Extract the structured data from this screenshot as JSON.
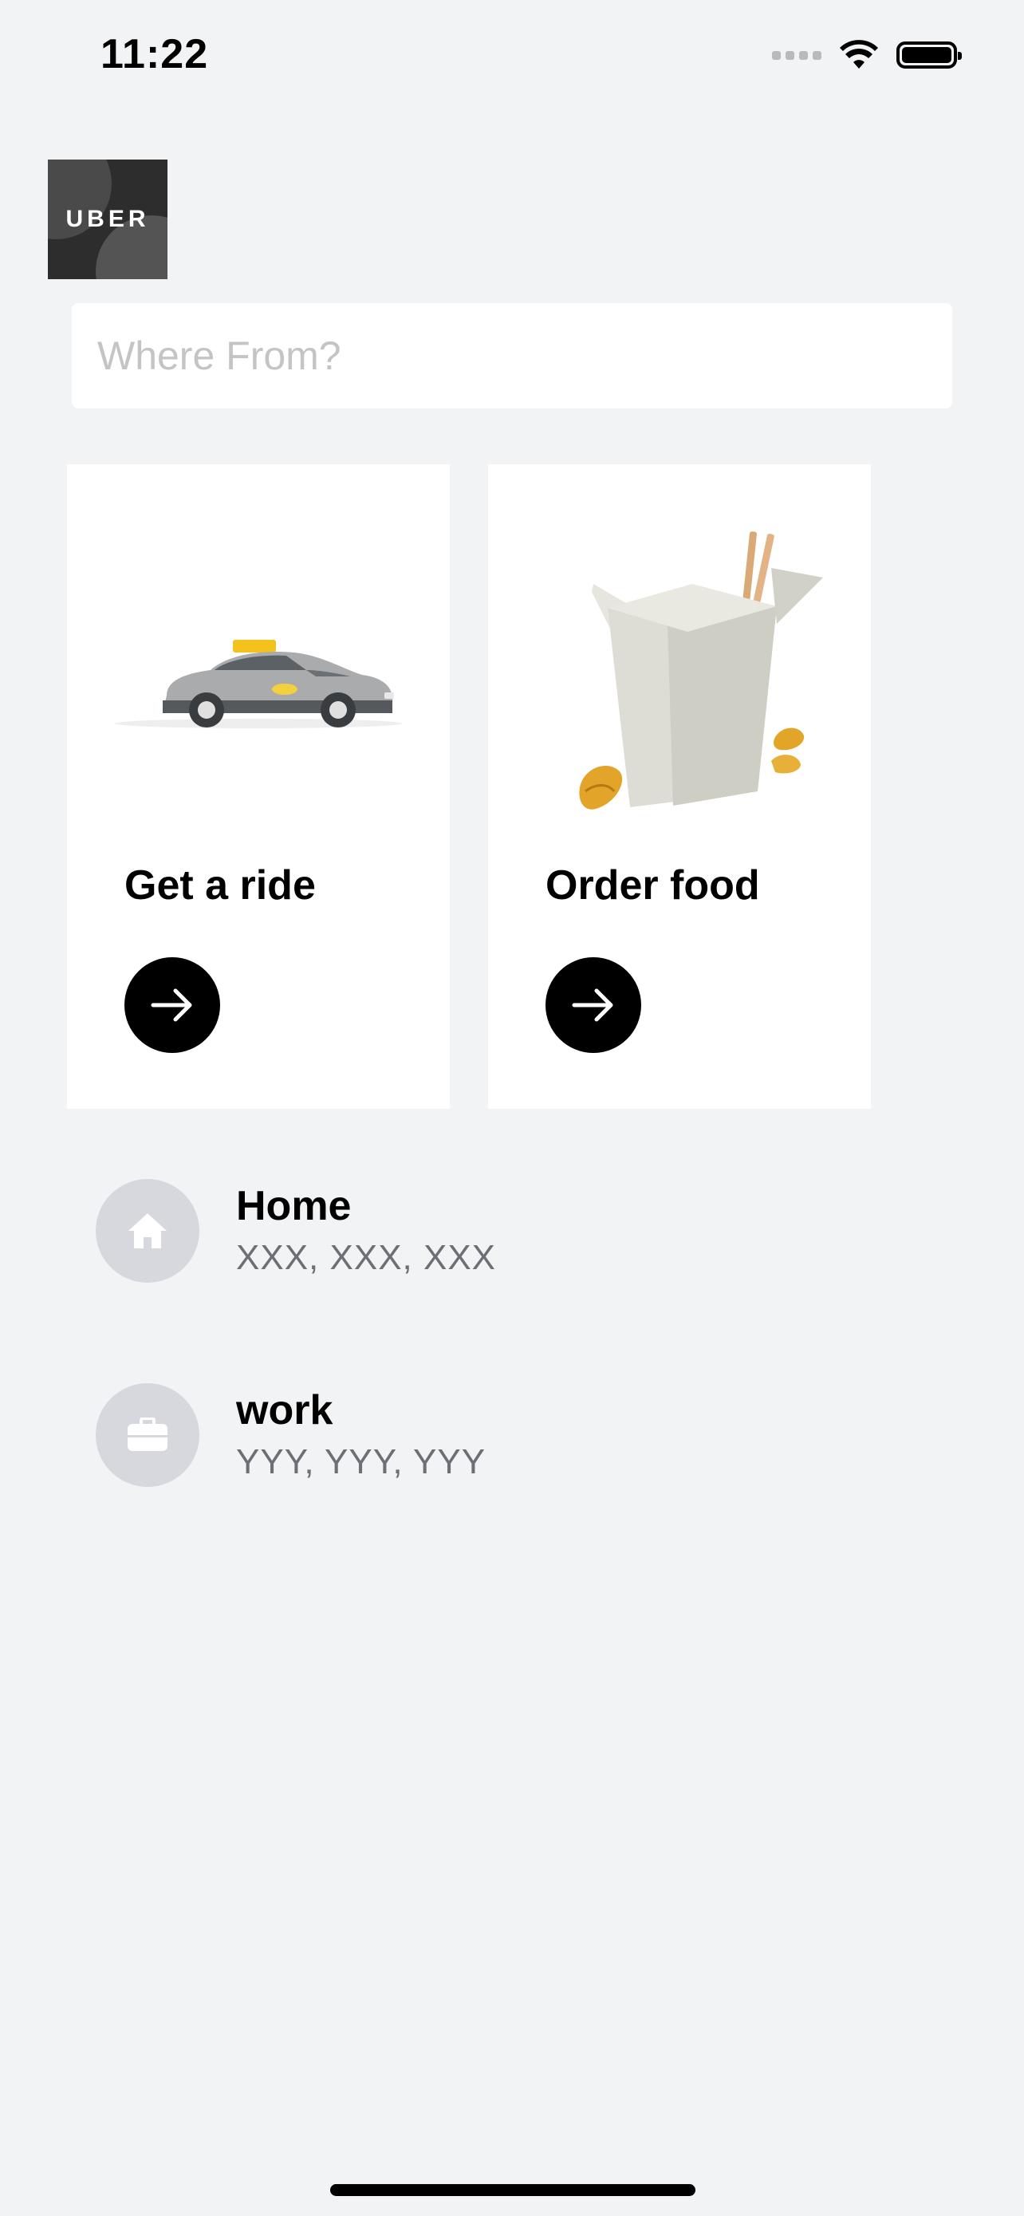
{
  "status_bar": {
    "time": "11:22"
  },
  "logo": {
    "text": "UBER"
  },
  "search": {
    "placeholder": "Where From?",
    "value": ""
  },
  "cards": [
    {
      "title": "Get a ride",
      "image": "taxi-car-image",
      "button_icon": "arrow-right-icon"
    },
    {
      "title": "Order food",
      "image": "takeout-box-image",
      "button_icon": "arrow-right-icon"
    }
  ],
  "saved_places": [
    {
      "name": "Home",
      "address": "XXX, XXX, XXX",
      "icon": "home-icon"
    },
    {
      "name": "work",
      "address": "YYY, YYY, YYY",
      "icon": "briefcase-icon"
    }
  ],
  "colors": {
    "background": "#f2f3f5",
    "card_background": "#ffffff",
    "button": "#000000",
    "place_icon_bg": "#d7d8dd",
    "secondary_text": "#6e6f76",
    "taxi_sign": "#f4c21d"
  }
}
